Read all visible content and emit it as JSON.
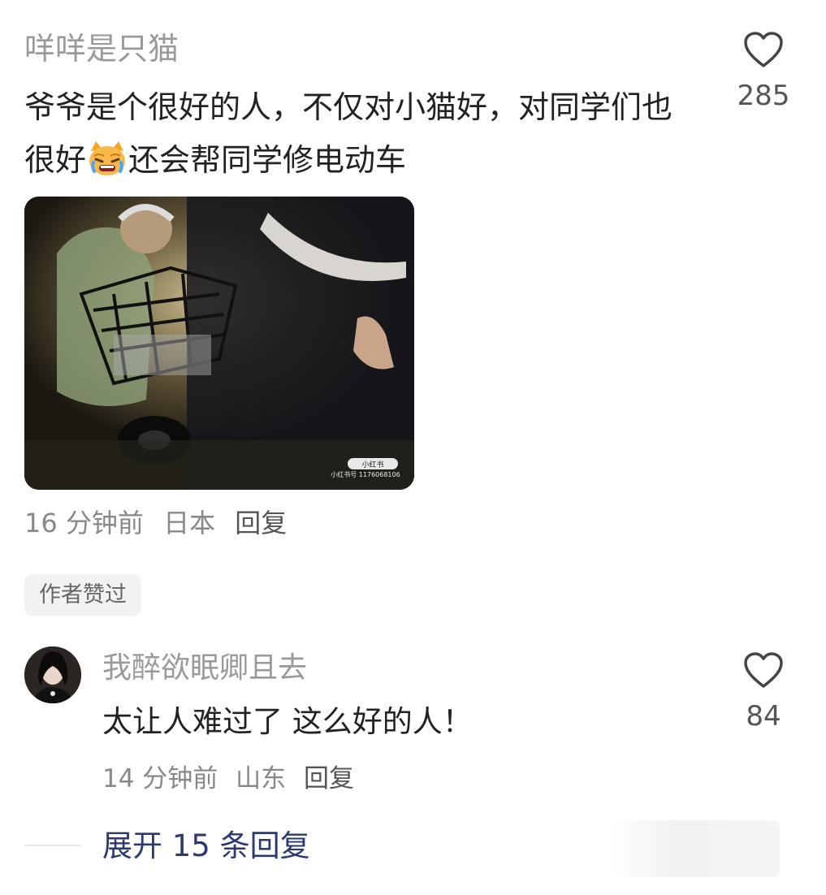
{
  "main_comment": {
    "username": "咩咩是只猫",
    "text_before_emoji": "爷爷是个很好的人，不仅对小猫好，对同学们也很好",
    "emoji": "crying-cat-emoji",
    "text_after_emoji": "还会帮同学修电动车",
    "likes": "285",
    "time": "16 分钟前",
    "location": "日本",
    "reply_label": "回复",
    "photo_watermark_brand": "小红书",
    "photo_watermark_id": "小红书号 1176068106"
  },
  "author_liked_badge": "作者赞过",
  "reply_comment": {
    "username": "我醉欲眠卿且去",
    "text": "太让人难过了 这么好的人！",
    "likes": "84",
    "time": "14 分钟前",
    "location": "山东",
    "reply_label": "回复"
  },
  "expand_replies_label": "展开 15 条回复",
  "colors": {
    "username_gray": "#9a9a9a",
    "text_dark": "#222222",
    "expand_link": "#2b3a6e"
  }
}
